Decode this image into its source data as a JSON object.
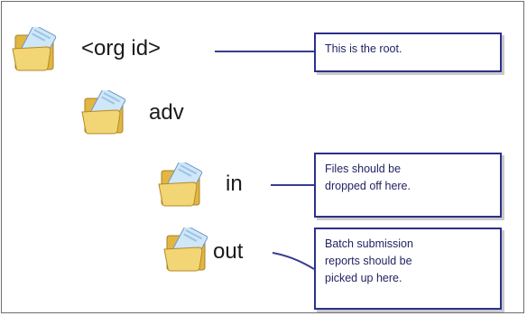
{
  "tree": {
    "root_label": "<org id>",
    "adv_label": "adv",
    "in_label": "in",
    "out_label": "out"
  },
  "notes": {
    "root": "This is the root.",
    "in_line1": "Files should be",
    "in_line2": "dropped off here.",
    "out_line1": "Batch submission",
    "out_line2": "reports should be",
    "out_line3": "picked up here."
  },
  "icons": {
    "folder": "open-folder-icon"
  },
  "colors": {
    "note_border": "#2d2f8c",
    "note_text": "#232365",
    "connector": "#3a3c8f",
    "folder_body": "#f2d574",
    "folder_back": "#e2b642",
    "paper": "#cfe7f7"
  }
}
